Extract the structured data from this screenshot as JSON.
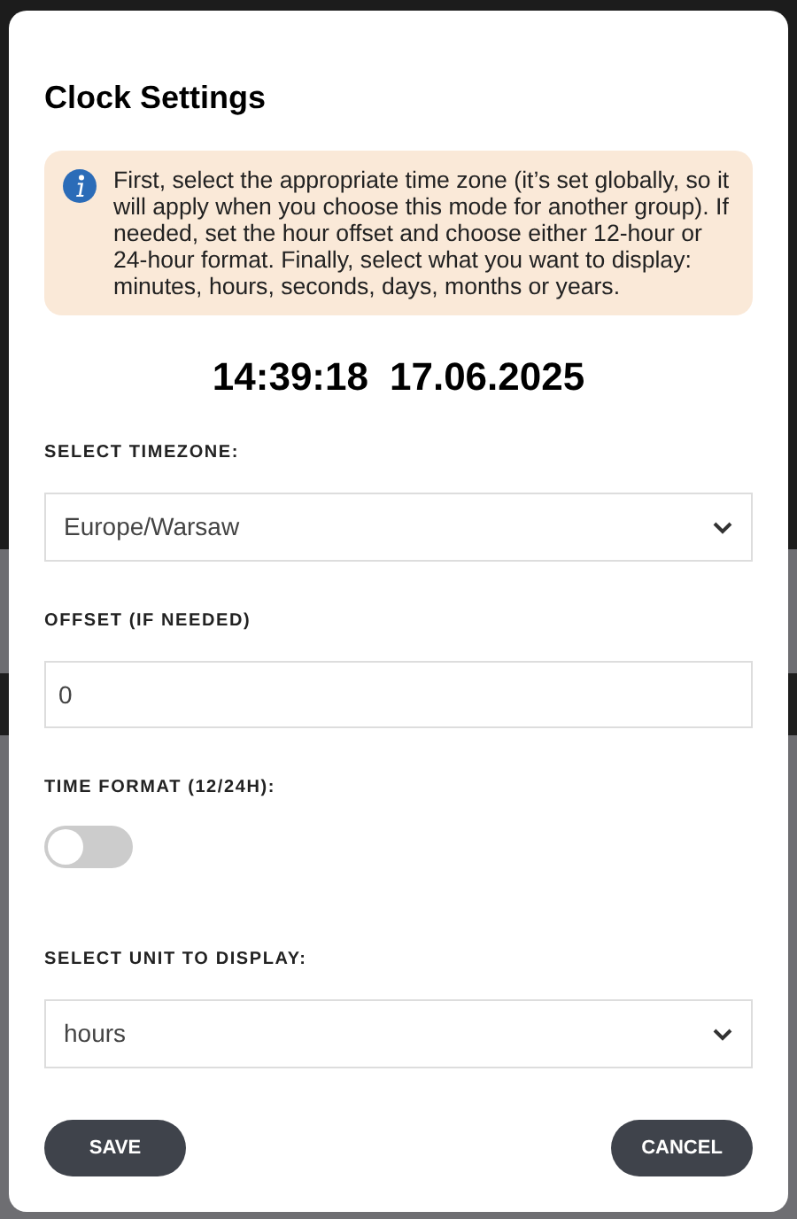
{
  "dialog": {
    "title": "Clock Settings",
    "info": "First, select the appropriate time zone (it’s set globally, so it will apply when you choose this mode for another group). If needed, set the hour offset and choose either 12-hour or 24-hour format. Finally, select what you want to display: minutes, hours, seconds, days, months or years.",
    "time": "14:39:18",
    "date": "17.06.2025",
    "fields": [
      {
        "kind": "select",
        "label": "SELECT TIMEZONE:",
        "value": "Europe/Warsaw"
      },
      {
        "kind": "input",
        "label": "OFFSET (IF NEEDED)",
        "value": "0"
      },
      {
        "kind": "toggle",
        "label": "TIME FORMAT (12/24H):",
        "on": false
      },
      {
        "kind": "select",
        "label": "SELECT UNIT TO DISPLAY:",
        "value": "hours"
      }
    ],
    "buttons": [
      "SAVE",
      "CANCEL"
    ]
  }
}
